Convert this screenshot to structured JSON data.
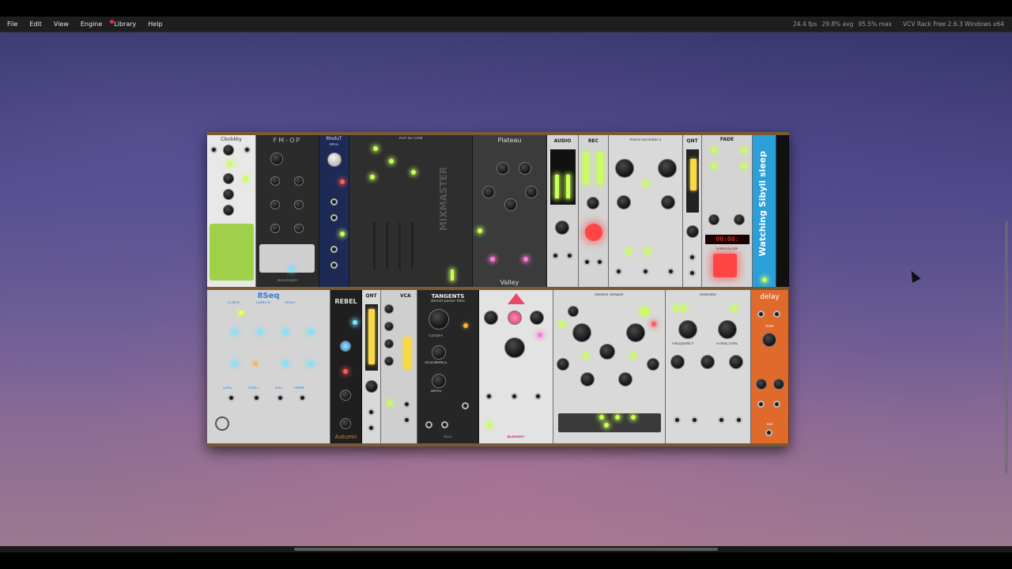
{
  "menu": {
    "file": "File",
    "edit": "Edit",
    "view": "View",
    "engine": "Engine",
    "library": "Library",
    "help": "Help"
  },
  "status": {
    "fps": "24.4 fps",
    "avg": "29.8% avg",
    "max": "95.5% max",
    "version": "VCV Rack Free 2.6.3 Windows x64"
  },
  "modules_row1": [
    {
      "label": "Clockkky"
    },
    {
      "label": "FM-OP"
    },
    {
      "label": "BOGAUDIO"
    },
    {
      "label": "ModuT"
    },
    {
      "label": "RATE"
    },
    {
      "label": "AUX RETURN"
    },
    {
      "label": "MIXMASTER"
    },
    {
      "label": "Plateau"
    },
    {
      "label": "Valley"
    },
    {
      "label": "AUDIO"
    },
    {
      "label": "REC"
    },
    {
      "label": "macro oscillator 2"
    },
    {
      "label": "QNT"
    },
    {
      "label": "FADE"
    },
    {
      "label": "START/STOP"
    }
  ],
  "modules_row2": [
    {
      "label": "8Seq"
    },
    {
      "label": "CLOCK"
    },
    {
      "label": "LENGTH"
    },
    {
      "label": "RESET"
    },
    {
      "label": "GATE"
    },
    {
      "label": "V/OCT"
    },
    {
      "label": "EOC"
    },
    {
      "label": "PROB"
    },
    {
      "label": "REBEL"
    },
    {
      "label": "Autumn"
    },
    {
      "label": "QNT"
    },
    {
      "label": "VCA"
    },
    {
      "label": "TANGENTS"
    },
    {
      "label": "steiner-parker filter"
    },
    {
      "label": "CUTOFF"
    },
    {
      "label": "RESONANCE"
    },
    {
      "label": "DRIVE"
    },
    {
      "label": "VULT"
    },
    {
      "label": "ALRIGHT"
    },
    {
      "label": "random sampler"
    },
    {
      "label": "resonator"
    },
    {
      "label": "FREQUENCY"
    },
    {
      "label": "STRUCTURE"
    },
    {
      "label": "delay"
    },
    {
      "label": "time"
    },
    {
      "label": "out"
    }
  ],
  "note_module": {
    "text": "Watching Sibyll sleep"
  },
  "colors": {
    "menubar": "#1e1e1e",
    "rack_wood": "#5e4628",
    "led_green": "#c9ff57",
    "led_blue": "#7de3ff",
    "delay_orange": "#e06a2c",
    "note_blue": "#2b9fd8"
  }
}
